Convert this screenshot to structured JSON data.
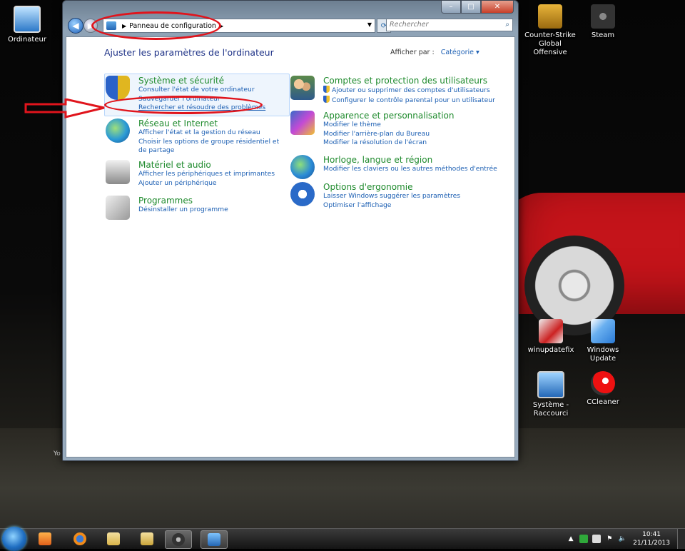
{
  "desktop": {
    "icons": [
      {
        "name": "desktop-icon-ordinateur",
        "label": "Ordinateur"
      },
      {
        "name": "desktop-icon-counter-strike",
        "label": "Counter-Strike Global Offensive"
      },
      {
        "name": "desktop-icon-steam",
        "label": "Steam"
      },
      {
        "name": "desktop-icon-winupdatefix",
        "label": "winupdatefix"
      },
      {
        "name": "desktop-icon-windows-update",
        "label": "Windows Update"
      },
      {
        "name": "desktop-icon-systeme-raccourci",
        "label": "Système - Raccourci"
      },
      {
        "name": "desktop-icon-ccleaner",
        "label": "CCleaner"
      }
    ],
    "stray_text": "Yo"
  },
  "window": {
    "address_path": "Panneau de configuration",
    "search_placeholder": "Rechercher",
    "controls": {
      "minimize": "–",
      "maximize": "□",
      "close": "✕"
    },
    "page_title": "Ajuster les paramètres de l'ordinateur",
    "view_by_label": "Afficher par :",
    "view_by_value": "Catégorie",
    "categories_left": [
      {
        "title": "Système et sécurité",
        "links": [
          "Consulter l'état de votre ordinateur",
          "Sauvegarder l'ordinateur",
          "Rechercher et résoudre des problèmes"
        ]
      },
      {
        "title": "Réseau et Internet",
        "links": [
          "Afficher l'état et la gestion du réseau",
          "Choisir les options de groupe résidentiel et de partage"
        ]
      },
      {
        "title": "Matériel et audio",
        "links": [
          "Afficher les périphériques et imprimantes",
          "Ajouter un périphérique"
        ]
      },
      {
        "title": "Programmes",
        "links": [
          "Désinstaller un programme"
        ]
      }
    ],
    "categories_right": [
      {
        "title": "Comptes et protection des utilisateurs",
        "links": [
          "Ajouter ou supprimer des comptes d'utilisateurs",
          "Configurer le contrôle parental pour un utilisateur"
        ]
      },
      {
        "title": "Apparence et personnalisation",
        "links": [
          "Modifier le thème",
          "Modifier l'arrière-plan du Bureau",
          "Modifier la résolution de l'écran"
        ]
      },
      {
        "title": "Horloge, langue et région",
        "links": [
          "Modifier les claviers ou les autres méthodes d'entrée"
        ]
      },
      {
        "title": "Options d'ergonomie",
        "links": [
          "Laisser Windows suggérer les paramètres",
          "Optimiser l'affichage"
        ]
      }
    ]
  },
  "taskbar": {
    "clock_time": "10:41",
    "clock_date": "21/11/2013"
  },
  "colors": {
    "link": "#1c5fb3",
    "category_title": "#1e8a2c",
    "annotation_red": "#e0141c"
  }
}
